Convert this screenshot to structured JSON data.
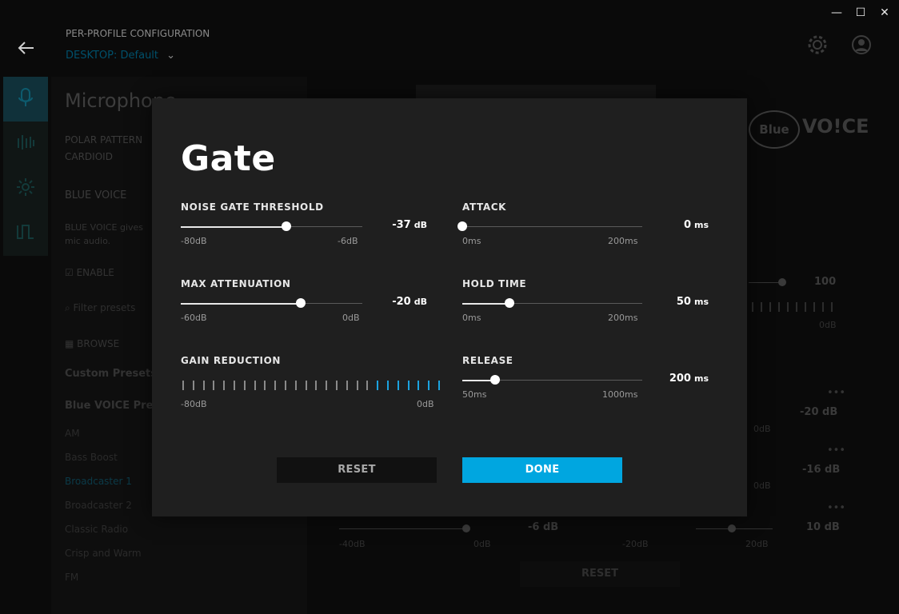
{
  "window": {
    "minimize_glyph": "—",
    "maximize_glyph": "☐",
    "close_glyph": "✕"
  },
  "background": {
    "back_icon": "arrow-left-icon",
    "config_label": "PER-PROFILE CONFIGURATION",
    "profile_label": "DESKTOP: Default",
    "title": "Microphone",
    "polar_pattern_label": "POLAR PATTERN",
    "polar_pattern_value": "CARDIOID",
    "blue_voice_tab": "BLUE VOICE",
    "description": "BLUE VOICE gives",
    "description2": "mic audio.",
    "enable_label": "ENABLE",
    "filter_placeholder": "Filter presets",
    "browse_label": "BROWSE",
    "custom_presets": "Custom Presets",
    "blue_voice_presets": "Blue VOICE Presets",
    "presets": [
      "AM",
      "Bass Boost",
      "Broadcaster 1",
      "Broadcaster 2",
      "Classic Radio",
      "Crisp and Warm",
      "FM"
    ],
    "logo_text": "VO!CE",
    "logo_badge": "Blue",
    "right_values": [
      "100",
      "0dB",
      "-20 dB",
      "0dB",
      "-16 dB",
      "0dB",
      "10 dB",
      "-6 dB"
    ],
    "bottom_labels": [
      "-40dB",
      "0dB",
      "-20dB",
      "20dB"
    ],
    "bottom_reset": "RESET"
  },
  "modal": {
    "title": "Gate",
    "noise_gate": {
      "label": "NOISE GATE THRESHOLD",
      "value": "-37",
      "unit": "dB",
      "min": "-80dB",
      "max": "-6dB",
      "fraction": 0.58
    },
    "max_attenuation": {
      "label": "MAX ATTENUATION",
      "value": "-20",
      "unit": "dB",
      "min": "-60dB",
      "max": "0dB",
      "fraction": 0.66
    },
    "gain_reduction": {
      "label": "GAIN REDUCTION",
      "min": "-80dB",
      "max": "0dB",
      "total_ticks": 26,
      "active_ticks": 7
    },
    "attack": {
      "label": "ATTACK",
      "value": "0",
      "unit": "ms",
      "min": "0ms",
      "max": "200ms",
      "fraction": 0.0
    },
    "hold_time": {
      "label": "HOLD TIME",
      "value": "50",
      "unit": "ms",
      "min": "0ms",
      "max": "200ms",
      "fraction": 0.26
    },
    "release": {
      "label": "RELEASE",
      "value": "200",
      "unit": "ms",
      "min": "50ms",
      "max": "1000ms",
      "fraction": 0.18
    },
    "reset_label": "RESET",
    "done_label": "DONE"
  },
  "colors": {
    "accent": "#00a6e0",
    "modal_bg": "#1f1f1f",
    "meter_active": "#1ba3e0"
  }
}
